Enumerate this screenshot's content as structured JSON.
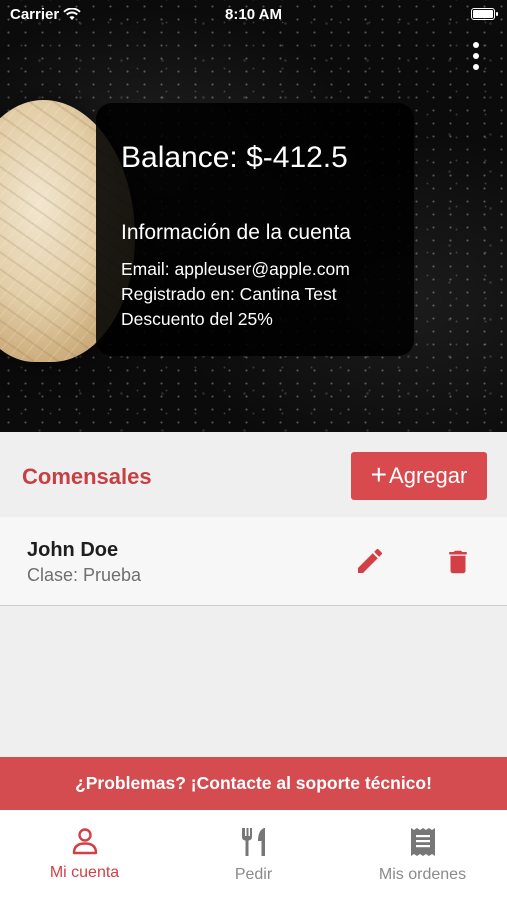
{
  "status_bar": {
    "carrier": "Carrier",
    "time": "8:10 AM"
  },
  "account": {
    "balance": "Balance: $-412.5",
    "info_title": "Información de la cuenta",
    "email": "Email: appleuser@apple.com",
    "registered": "Registrado en: Cantina Test",
    "discount": "Descuento del 25%"
  },
  "diners": {
    "title": "Comensales",
    "add_label": "Agregar",
    "items": [
      {
        "name": "John Doe",
        "class": "Clase: Prueba"
      }
    ]
  },
  "support": {
    "text": "¿Problemas? ¡Contacte al soporte técnico!"
  },
  "tabs": [
    {
      "label": "Mi cuenta",
      "icon": "user-icon",
      "active": true
    },
    {
      "label": "Pedir",
      "icon": "fork-knife-icon",
      "active": false
    },
    {
      "label": "Mis ordenes",
      "icon": "receipt-icon",
      "active": false
    }
  ],
  "colors": {
    "accent": "#d94a4e",
    "title_red": "#c64043",
    "support_bar": "#d44c50",
    "active_tab": "#d33f44",
    "inactive_tab": "#8a8a8a"
  }
}
